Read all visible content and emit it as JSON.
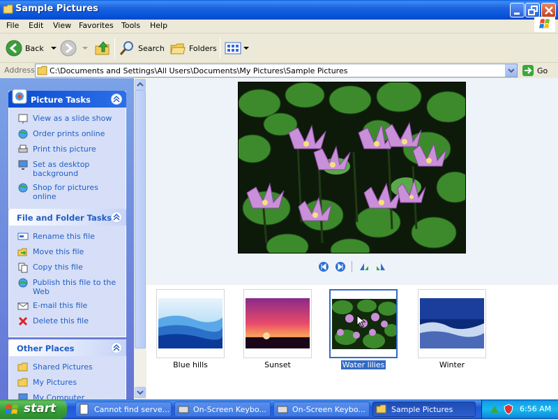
{
  "window": {
    "title": "Sample Pictures"
  },
  "menu": [
    "File",
    "Edit",
    "View",
    "Favorites",
    "Tools",
    "Help"
  ],
  "toolbar": {
    "back_label": "Back",
    "search_label": "Search",
    "folders_label": "Folders"
  },
  "address": {
    "label": "Address",
    "value": "C:\\Documents and Settings\\All Users\\Documents\\My Pictures\\Sample Pictures",
    "go_label": "Go"
  },
  "picture_tasks": {
    "title": "Picture Tasks",
    "items": [
      {
        "label": "View as a slide show",
        "icon": "slideshow-icon"
      },
      {
        "label": "Order prints online",
        "icon": "globe-icon"
      },
      {
        "label": "Print this picture",
        "icon": "printer-icon"
      },
      {
        "label": "Set as desktop background",
        "icon": "desktop-icon"
      },
      {
        "label": "Shop for pictures online",
        "icon": "globe-icon"
      }
    ]
  },
  "file_tasks": {
    "title": "File and Folder Tasks",
    "items": [
      {
        "label": "Rename this file",
        "icon": "rename-icon"
      },
      {
        "label": "Move this file",
        "icon": "move-icon"
      },
      {
        "label": "Copy this file",
        "icon": "copy-icon"
      },
      {
        "label": "Publish this file to the Web",
        "icon": "publish-icon"
      },
      {
        "label": "E-mail this file",
        "icon": "email-icon"
      },
      {
        "label": "Delete this file",
        "icon": "delete-icon"
      }
    ]
  },
  "other_places": {
    "title": "Other Places",
    "items": [
      {
        "label": "Shared Pictures",
        "icon": "folder-icon"
      },
      {
        "label": "My Pictures",
        "icon": "folder-icon"
      },
      {
        "label": "My Computer",
        "icon": "computer-icon"
      }
    ]
  },
  "thumbnails": [
    {
      "label": "Blue hills",
      "selected": false
    },
    {
      "label": "Sunset",
      "selected": false
    },
    {
      "label": "Water lilies",
      "selected": true
    },
    {
      "label": "Winter",
      "selected": false
    }
  ],
  "taskbar": {
    "start_label": "start",
    "items": [
      {
        "label": "Cannot find serve...",
        "active": false
      },
      {
        "label": "On-Screen Keybo...",
        "active": false
      },
      {
        "label": "On-Screen Keybo...",
        "active": false
      },
      {
        "label": "Sample Pictures",
        "active": true
      }
    ],
    "clock": "6:56 AM"
  },
  "colors": {
    "titlebar": "#0452d8",
    "task_link": "#215dc6",
    "selection": "#316ac5",
    "start_green": "#38a038"
  }
}
